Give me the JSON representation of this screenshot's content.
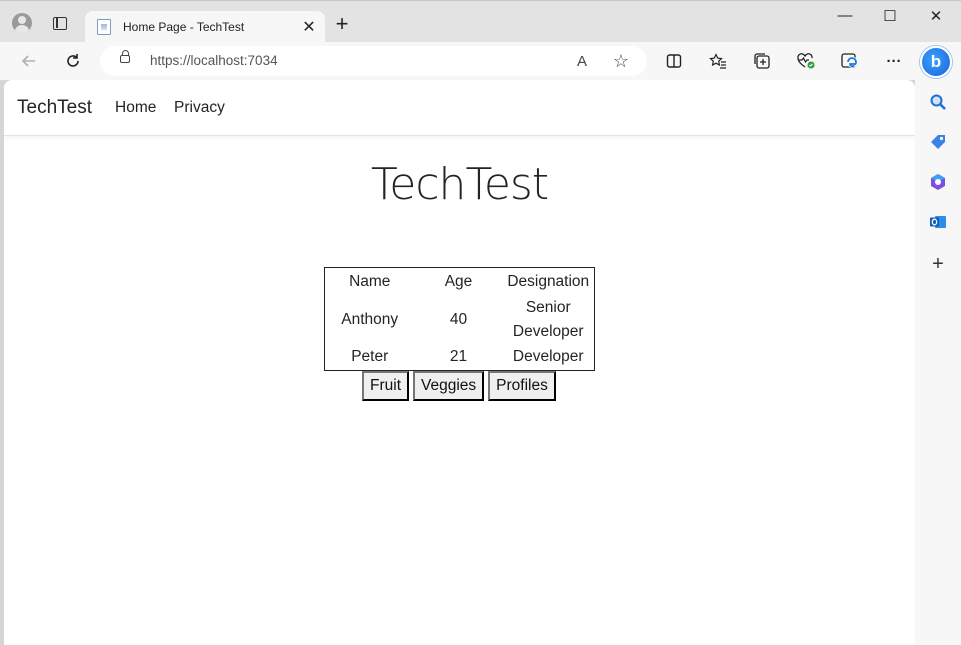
{
  "browser": {
    "tab_title": "Home Page - TechTest",
    "tab_close": "✕",
    "new_tab": "+",
    "url": "https://localhost:7034",
    "window_controls": {
      "minimize": "—",
      "maximize": "☐",
      "close": "✕"
    },
    "icons": {
      "back": "back-arrow-icon",
      "refresh": "refresh-icon",
      "read_aloud": "read-aloud-icon",
      "favorite": "star-icon",
      "split": "split-screen-icon",
      "favorites": "favorites-list-icon",
      "collections": "collections-icon",
      "health": "browser-essentials-icon",
      "edge_ext": "edge-icon",
      "more": "more-icon",
      "bing": "bing-icon"
    },
    "toolbar_glyphs": {
      "read_aloud": "A",
      "star": "☆",
      "more": "···",
      "bing": "b"
    }
  },
  "sidebar": {
    "icons": [
      "search-icon",
      "tag-icon",
      "office-icon",
      "outlook-icon",
      "add-icon"
    ],
    "add_glyph": "+"
  },
  "page": {
    "brand": "TechTest",
    "nav": [
      {
        "label": "Home"
      },
      {
        "label": "Privacy"
      }
    ],
    "heading": "TechTest",
    "table": {
      "headers": [
        "Name",
        "Age",
        "Designation"
      ],
      "rows": [
        {
          "name": "Anthony",
          "age": "40",
          "designation_line1": "Senior",
          "designation_line2": "Developer"
        },
        {
          "name": "Peter",
          "age": "21",
          "designation": "Developer"
        }
      ]
    },
    "buttons": [
      "Fruit",
      "Veggies",
      "Profiles"
    ]
  }
}
